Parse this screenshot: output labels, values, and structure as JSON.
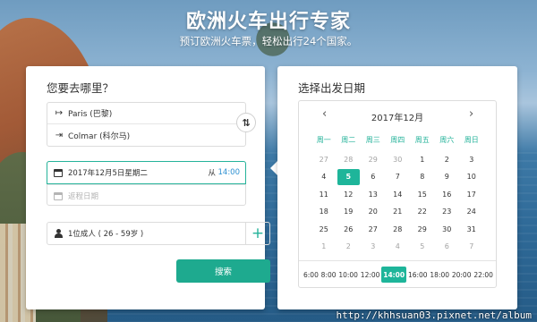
{
  "header": {
    "title": "欧洲火车出行专家",
    "subtitle": "预订欧洲火车票，轻松出行24个国家。"
  },
  "search_form": {
    "title": "您要去哪里？",
    "from_station": "Paris (巴黎)",
    "to_station": "Colmar (科尔马)",
    "depart_date": "2017年12月5日星期二",
    "depart_from_label": "从",
    "depart_time": "14:00",
    "return_placeholder": "返程日期",
    "passengers": "1位成人 ( 26 - 59岁 )",
    "search_label": "搜索",
    "icons": {
      "from": "depart-icon",
      "to": "arrive-icon",
      "swap": "swap-icon",
      "date": "calendar-icon",
      "passenger": "person-icon",
      "add": "plus-icon"
    }
  },
  "date_picker": {
    "title": "选择出发日期",
    "month_label": "2017年12月",
    "prev_icon": "‹",
    "next_icon": "›",
    "weekdays": [
      "周一",
      "周二",
      "周三",
      "周四",
      "周五",
      "周六",
      "周日"
    ],
    "weeks": [
      [
        {
          "d": "27",
          "dim": true
        },
        {
          "d": "28",
          "dim": true
        },
        {
          "d": "29",
          "dim": true
        },
        {
          "d": "30",
          "dim": true
        },
        {
          "d": "1"
        },
        {
          "d": "2"
        },
        {
          "d": "3"
        }
      ],
      [
        {
          "d": "4"
        },
        {
          "d": "5",
          "selected": true
        },
        {
          "d": "6"
        },
        {
          "d": "7"
        },
        {
          "d": "8"
        },
        {
          "d": "9"
        },
        {
          "d": "10"
        }
      ],
      [
        {
          "d": "11"
        },
        {
          "d": "12"
        },
        {
          "d": "13"
        },
        {
          "d": "14"
        },
        {
          "d": "15"
        },
        {
          "d": "16"
        },
        {
          "d": "17"
        }
      ],
      [
        {
          "d": "18"
        },
        {
          "d": "19"
        },
        {
          "d": "20"
        },
        {
          "d": "21"
        },
        {
          "d": "22"
        },
        {
          "d": "23"
        },
        {
          "d": "24"
        }
      ],
      [
        {
          "d": "25"
        },
        {
          "d": "26"
        },
        {
          "d": "27"
        },
        {
          "d": "28"
        },
        {
          "d": "29"
        },
        {
          "d": "30"
        },
        {
          "d": "31"
        }
      ],
      [
        {
          "d": "1",
          "dim": true
        },
        {
          "d": "2",
          "dim": true
        },
        {
          "d": "3",
          "dim": true
        },
        {
          "d": "4",
          "dim": true
        },
        {
          "d": "5",
          "dim": true
        },
        {
          "d": "6",
          "dim": true
        },
        {
          "d": "7",
          "dim": true
        }
      ]
    ],
    "times": [
      "6:00",
      "8:00",
      "10:00",
      "12:00",
      "14:00",
      "16:00",
      "18:00",
      "20:00",
      "22:00"
    ],
    "selected_time": "14:00"
  },
  "watermark": "http://khhsuan03.pixnet.net/album",
  "colors": {
    "accent": "#1eb59a",
    "time_link": "#2a8fd1"
  }
}
